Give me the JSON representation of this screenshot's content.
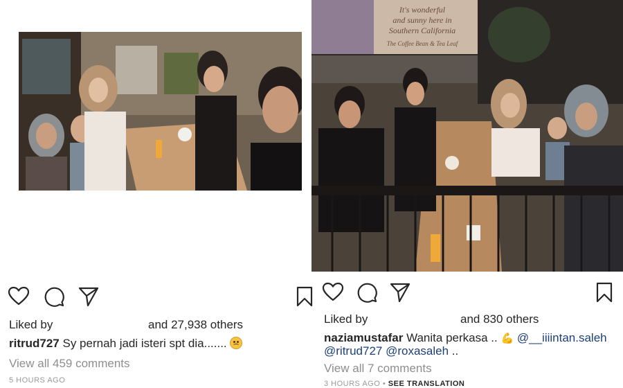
{
  "left_post": {
    "liked_by_label": "Liked by",
    "likes_text": "and 27,938 others",
    "caption_user": "ritrud727",
    "caption_text": "Sy pernah jadi isteri spt dia.......",
    "caption_emoji": "upside-down-face-emoji",
    "view_comments": "View all 459 comments",
    "timestamp": "5 HOURS AGO"
  },
  "right_post": {
    "liked_by_label": "Liked by",
    "likes_text": "and 830 others",
    "caption_user": "naziamustafar",
    "caption_text": "Wanita perkasa ..",
    "caption_emoji": "flexed-biceps-emoji",
    "mention_1": "@__iiiintan.saleh",
    "mention_2": "@ritrud727",
    "mention_3": "@roxasaleh",
    "caption_end": "..",
    "view_comments": "View all 7 comments",
    "timestamp": "3 HOURS AGO",
    "separator": "•",
    "see_translation": "SEE TRANSLATION",
    "poster_text_1": "It's wonderful",
    "poster_text_2": "and sunny here in",
    "poster_text_3": "Southern California",
    "poster_brand": "The Coffee Bean & Tea Leaf"
  },
  "icons": {
    "like": "heart-icon",
    "comment": "comment-bubble-icon",
    "share": "paper-plane-icon",
    "save": "bookmark-icon"
  },
  "colors": {
    "text": "#262626",
    "muted": "#8e8e8e",
    "mention": "#1c3f7a",
    "timestamp": "#999999"
  }
}
